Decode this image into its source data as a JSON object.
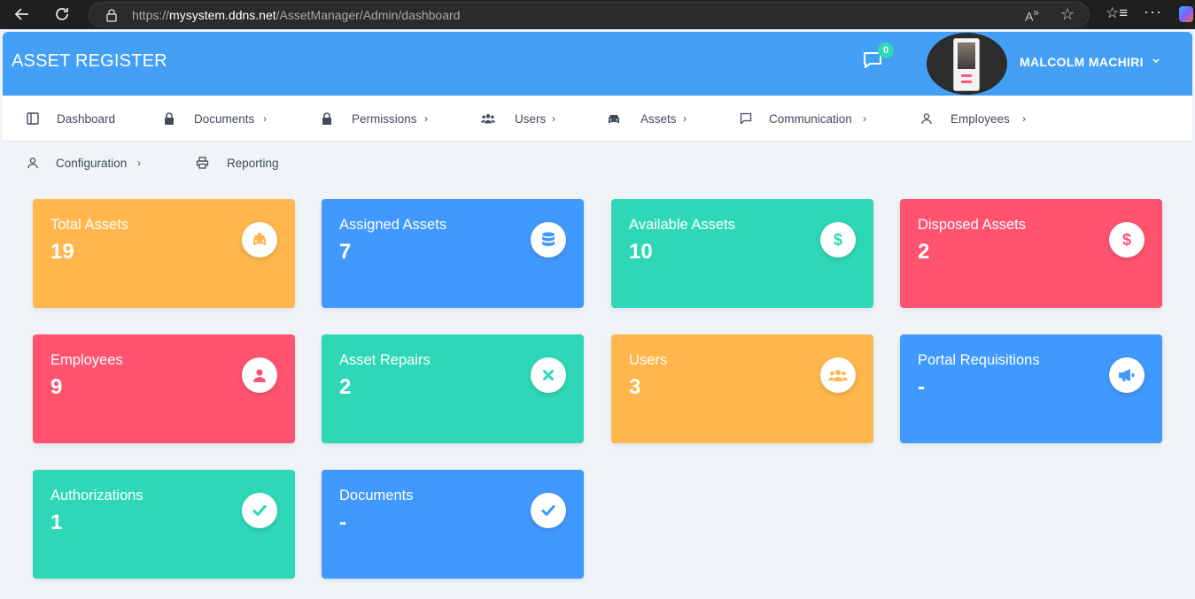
{
  "browser": {
    "url_prefix": "https://",
    "url_host": "mysystem.ddns.net",
    "url_path": "/AssetManager/Admin/dashboard"
  },
  "header": {
    "brand": "ASSET REGISTER",
    "message_count": "0",
    "username": "MALCOLM MACHIRI"
  },
  "nav": [
    {
      "label": "Dashboard",
      "icon": "sidebar-icon"
    },
    {
      "label": "Documents",
      "icon": "lock-icon"
    },
    {
      "label": "Permissions",
      "icon": "lock-icon"
    },
    {
      "label": "Users",
      "icon": "users-icon"
    },
    {
      "label": "Assets",
      "icon": "car-icon"
    },
    {
      "label": "Communication",
      "icon": "message-icon"
    },
    {
      "label": "Employees",
      "icon": "user-icon"
    },
    {
      "label": "Configuration",
      "icon": "user-icon"
    },
    {
      "label": "Reporting",
      "icon": "printer-icon"
    }
  ],
  "cards": [
    {
      "title": "Total Assets",
      "value": "19",
      "color": "#ffb64d",
      "icon": "taxi-icon"
    },
    {
      "title": "Assigned Assets",
      "value": "7",
      "color": "#4099ff",
      "icon": "database-icon"
    },
    {
      "title": "Available Assets",
      "value": "10",
      "color": "#2ed8b6",
      "icon": "dollar-icon"
    },
    {
      "title": "Disposed Assets",
      "value": "2",
      "color": "#ff5370",
      "icon": "dollar-icon"
    },
    {
      "title": "Employees",
      "value": "9",
      "color": "#ff5370",
      "icon": "user-icon"
    },
    {
      "title": "Asset Repairs",
      "value": "2",
      "color": "#2ed8b6",
      "icon": "times-icon"
    },
    {
      "title": "Users",
      "value": "3",
      "color": "#ffb64d",
      "icon": "users-icon"
    },
    {
      "title": "Portal Requisitions",
      "value": "-",
      "color": "#4099ff",
      "icon": "megaphone-icon"
    },
    {
      "title": "Authorizations",
      "value": "1",
      "color": "#2ed8b6",
      "icon": "check-icon"
    },
    {
      "title": "Documents",
      "value": "-",
      "color": "#4099ff",
      "icon": "check-icon"
    }
  ]
}
